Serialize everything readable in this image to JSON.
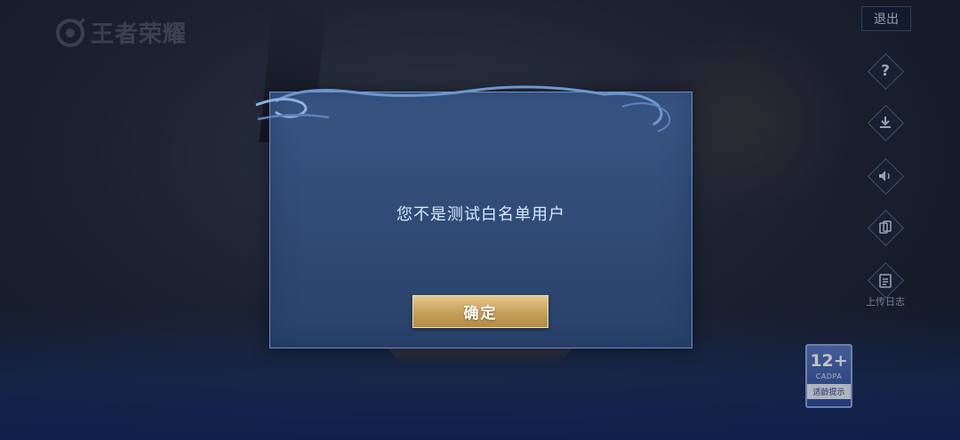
{
  "app": {
    "logo_text": "王者荣耀"
  },
  "topbar": {
    "exit_label": "退出"
  },
  "side_menu": {
    "help_icon": "question-icon",
    "download_icon": "download-icon",
    "sound_icon": "speaker-icon",
    "switch_icon": "card-switch-icon",
    "upload_log_icon": "clipboard-icon",
    "upload_log_label": "上传日志"
  },
  "age_rating": {
    "age": "12+",
    "org": "CADPA",
    "tip": "适龄提示"
  },
  "dialog": {
    "message": "您不是测试白名单用户",
    "confirm_label": "确定"
  },
  "colors": {
    "dialog_bg": "#34507c",
    "button_gold": "#c8a35e",
    "accent_border": "#6f8fc2"
  }
}
